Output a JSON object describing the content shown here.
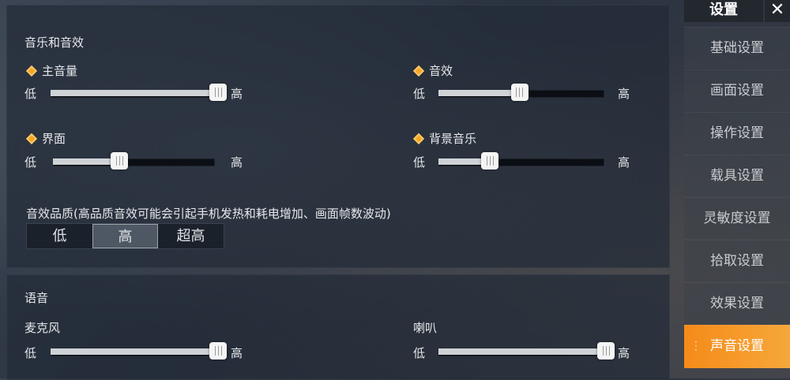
{
  "audio_panel": {
    "title": "音乐和音效",
    "sliders": {
      "master": {
        "label": "主音量",
        "low": "低",
        "high": "高",
        "value": 1.0
      },
      "sfx": {
        "label": "音效",
        "low": "低",
        "high": "高",
        "value": 0.49
      },
      "ui": {
        "label": "界面",
        "low": "低",
        "high": "高",
        "value": 0.41
      },
      "bgm": {
        "label": "背景音乐",
        "low": "低",
        "high": "高",
        "value": 0.31
      }
    },
    "quality": {
      "label": "音效品质(高品质音效可能会引起手机发热和耗电增加、画面帧数波动)",
      "options": [
        "低",
        "高",
        "超高"
      ],
      "selected": "高"
    }
  },
  "voice_panel": {
    "title": "语音",
    "sliders": {
      "mic": {
        "label": "麦克风",
        "low": "低",
        "high": "高",
        "value": 1.0
      },
      "speaker": {
        "label": "喇叭",
        "low": "低",
        "high": "高",
        "value": 1.0
      }
    }
  },
  "sidebar": {
    "title": "设置",
    "close": "✕",
    "items": [
      "基础设置",
      "画面设置",
      "操作设置",
      "载具设置",
      "灵敏度设置",
      "拾取设置",
      "效果设置",
      "声音设置"
    ],
    "active": "声音设置"
  },
  "colors": {
    "accent": "#f58b19",
    "diamond": "#f5a623"
  }
}
